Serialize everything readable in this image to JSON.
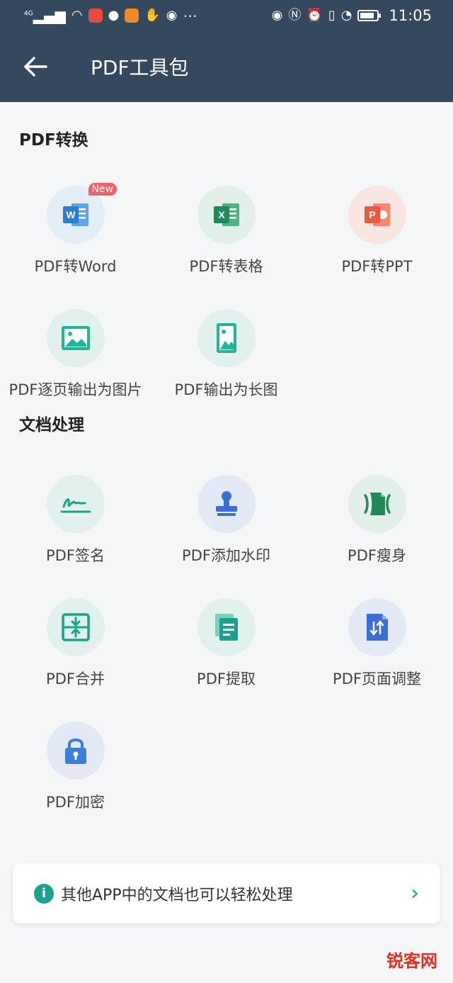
{
  "status": {
    "network": "4G",
    "time": "11:05",
    "battery_level": 0.85
  },
  "appbar": {
    "title": "PDF工具包"
  },
  "sections": [
    {
      "title": "PDF转换",
      "tools": [
        {
          "label": "PDF转Word",
          "badge": "New",
          "icon": "word-icon",
          "color": "#2b7cd3",
          "bg": "#e3eef6"
        },
        {
          "label": "PDF转表格",
          "icon": "excel-icon",
          "color": "#1e8a5a",
          "bg": "#e3efe9"
        },
        {
          "label": "PDF转PPT",
          "icon": "ppt-icon",
          "color": "#e55b43",
          "bg": "#f9e6e3"
        },
        {
          "label": "PDF逐页输出为图片",
          "icon": "image-icon",
          "color": "#23b39a",
          "bg": "#e2f1ee"
        },
        {
          "label": "PDF输出为长图",
          "icon": "long-image-icon",
          "color": "#23b39a",
          "bg": "#e2f1ee"
        }
      ]
    },
    {
      "title": "文档处理",
      "tools": [
        {
          "label": "PDF签名",
          "icon": "signature-icon",
          "color": "#1aa28c",
          "bg": "#e2f1ee"
        },
        {
          "label": "PDF添加水印",
          "icon": "stamp-icon",
          "color": "#3a6fd8",
          "bg": "#e4eaf5"
        },
        {
          "label": "PDF瘦身",
          "icon": "compress-icon",
          "color": "#1e8a5a",
          "bg": "#e3efe9"
        },
        {
          "label": "PDF合并",
          "icon": "merge-icon",
          "color": "#1aa28c",
          "bg": "#e2f1ee"
        },
        {
          "label": "PDF提取",
          "icon": "extract-icon",
          "color": "#1aa28c",
          "bg": "#e2f1ee"
        },
        {
          "label": "PDF页面调整",
          "icon": "page-adjust-icon",
          "color": "#3a6fd8",
          "bg": "#e4eaf5"
        },
        {
          "label": "PDF加密",
          "icon": "lock-icon",
          "color": "#3a7fd8",
          "bg": "#e4eaf5"
        }
      ]
    }
  ],
  "tip": {
    "text": "其他APP中的文档也可以轻松处理",
    "icon": "info-icon"
  },
  "watermark": {
    "text": "锐客网"
  }
}
